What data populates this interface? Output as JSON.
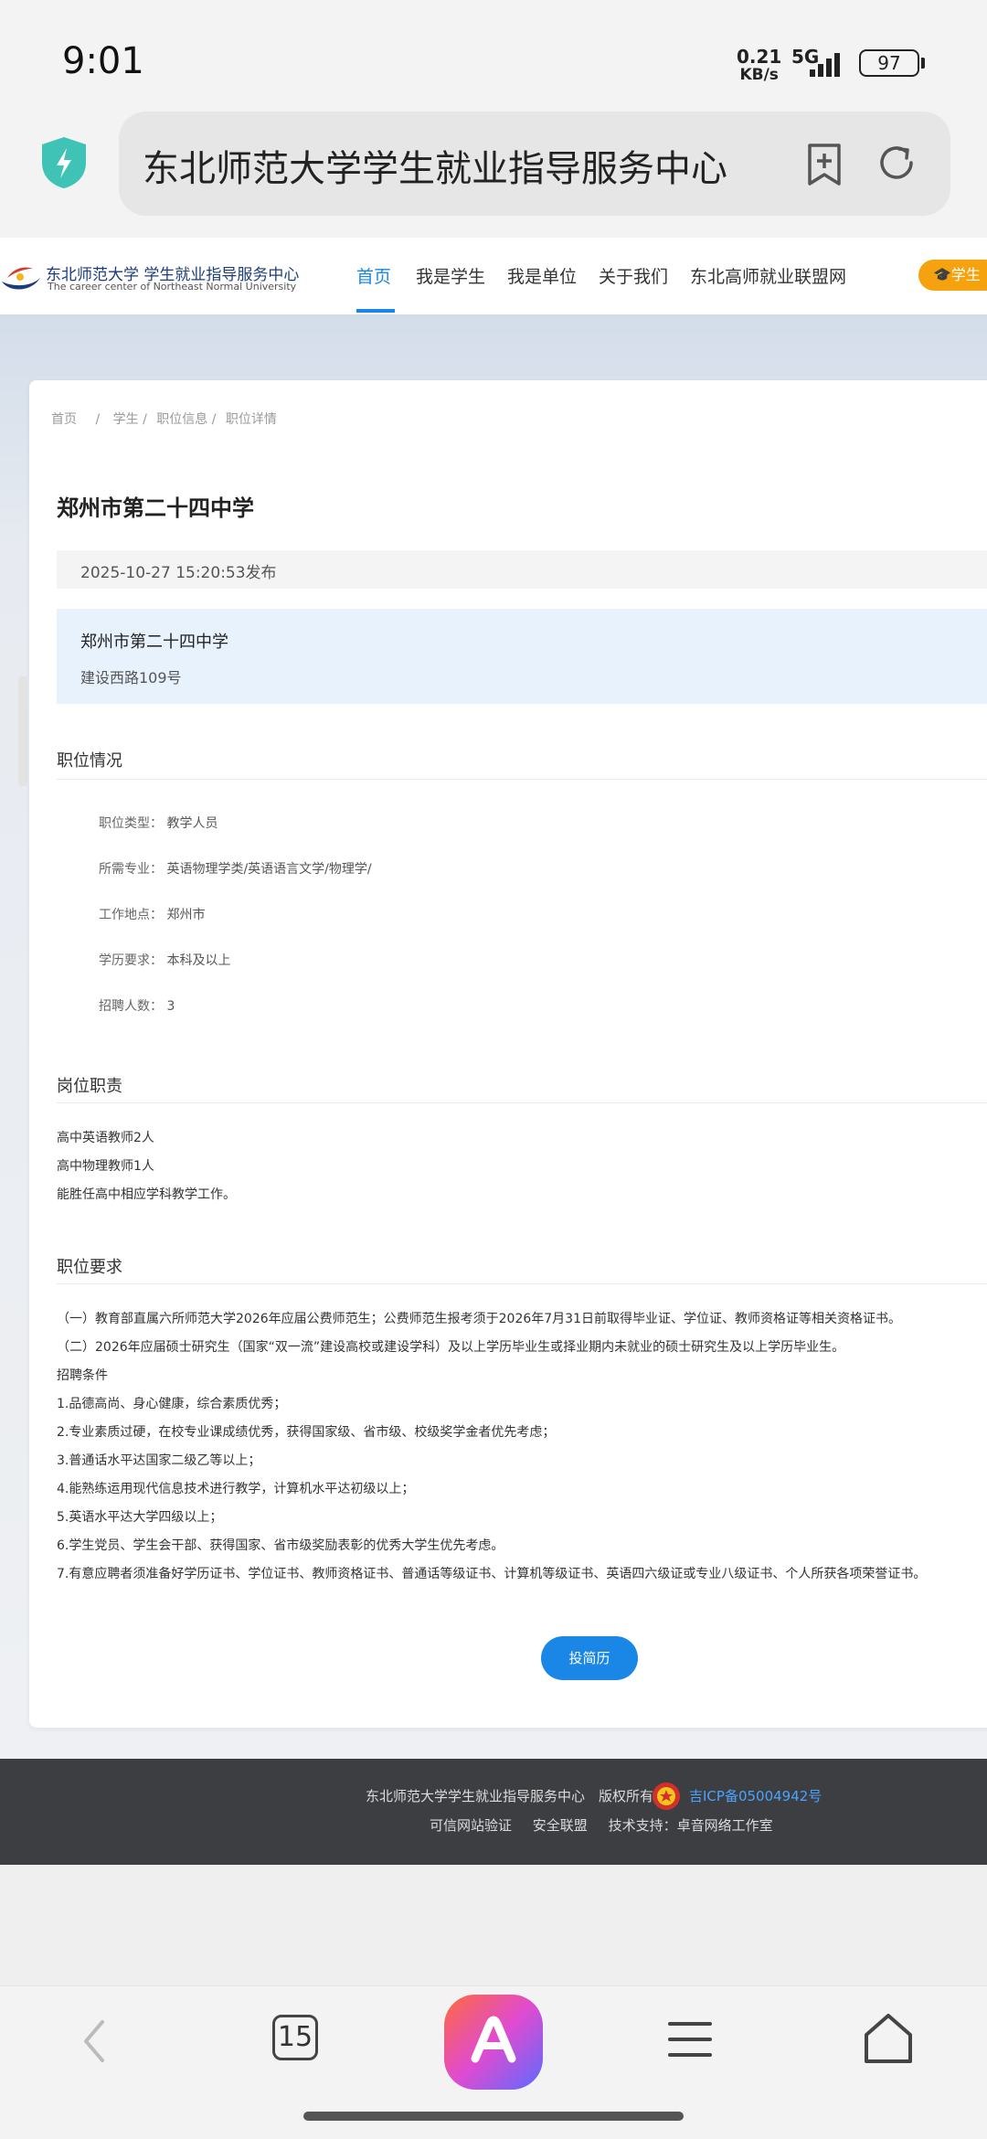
{
  "status_bar": {
    "time": "9:01",
    "net_speed_value": "0.21",
    "net_speed_unit": "KB/s",
    "network": "5G",
    "battery": "97"
  },
  "browser": {
    "url_title": "东北师范大学学生就业指导服务中心"
  },
  "site": {
    "logo_cn": "东北师范大学 学生就业指导服务中心",
    "logo_en": "The career center of Northeast Normal University",
    "nav": [
      "首页",
      "我是学生",
      "我是单位",
      "关于我们",
      "东北高师就业联盟网"
    ],
    "student_button": "学生"
  },
  "breadcrumb": [
    "首页",
    "/",
    "学生 /",
    "职位信息 /",
    "职位详情"
  ],
  "job": {
    "title": "郑州市第二十四中学",
    "published": "2025-10-27 15:20:53发布",
    "company_name": "郑州市第二十四中学",
    "company_address": "建设西路109号"
  },
  "position_info": {
    "title": "职位情况",
    "rows": [
      {
        "label": "职位类型：",
        "value": "教学人员"
      },
      {
        "label": "所需专业：",
        "value": "英语物理学类/英语语言文学/物理学/"
      },
      {
        "label": "工作地点：",
        "value": "郑州市"
      },
      {
        "label": "学历要求：",
        "value": "本科及以上"
      },
      {
        "label": "招聘人数：",
        "value": "3"
      }
    ]
  },
  "duties": {
    "title": "岗位职责",
    "lines": [
      "高中英语教师2人",
      "高中物理教师1人",
      "能胜任高中相应学科教学工作。"
    ]
  },
  "requirements": {
    "title": "职位要求",
    "lines": [
      "（一）教育部直属六所师范大学2026年应届公费师范生；公费师范生报考须于2026年7月31日前取得毕业证、学位证、教师资格证等相关资格证书。",
      "（二）2026年应届硕士研究生（国家“双一流”建设高校或建设学科）及以上学历毕业生或择业期内未就业的硕士研究生及以上学历毕业生。",
      "招聘条件",
      "1.品德高尚、身心健康，综合素质优秀；",
      "2.专业素质过硬，在校专业课成绩优秀，获得国家级、省市级、校级奖学金者优先考虑；",
      "3.普通话水平达国家二级乙等以上；",
      "4.能熟练运用现代信息技术进行教学，计算机水平达初级以上；",
      "5.英语水平达大学四级以上；",
      "6.学生党员、学生会干部、获得国家、省市级奖励表彰的优秀大学生优先考虑。",
      "7.有意应聘者须准备好学历证书、学位证书、教师资格证书、普通话等级证书、计算机等级证书、英语四六级证或专业八级证书、个人所获各项荣誉证书。"
    ]
  },
  "apply_button": "投简历",
  "footer": {
    "copyright": "东北师范大学学生就业指导服务中心　版权所有",
    "icp": "吉ICP备05004942号",
    "links": [
      "可信网站验证",
      "安全联盟",
      "技术支持：卓音网络工作室"
    ]
  },
  "bottom_nav": {
    "tabs_count": "15"
  }
}
